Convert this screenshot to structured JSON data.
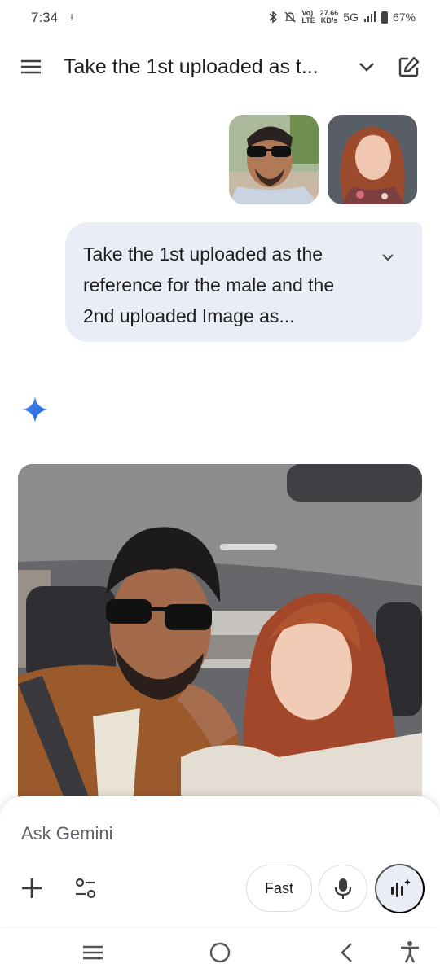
{
  "status_bar": {
    "time": "7:34",
    "download_indicator": "⭳",
    "speed_value": "27.66",
    "speed_unit": "KB/s",
    "volte_label": "Vo)",
    "lte_label": "LTE",
    "network": "5G",
    "battery": "67%"
  },
  "header": {
    "title": "Take the 1st uploaded as t...",
    "menu_icon": "hamburger-menu-icon",
    "dropdown_icon": "chevron-down-icon",
    "new_chat_icon": "edit-icon"
  },
  "user_message": {
    "text": "Take the 1st uploaded as the reference for the male and the 2nd uploaded Image as..."
  },
  "input": {
    "placeholder": "Ask Gemini"
  },
  "controls": {
    "fast_label": "Fast"
  },
  "colors": {
    "accent_blue": "#1a73e8",
    "bubble": "#e9eef6"
  }
}
